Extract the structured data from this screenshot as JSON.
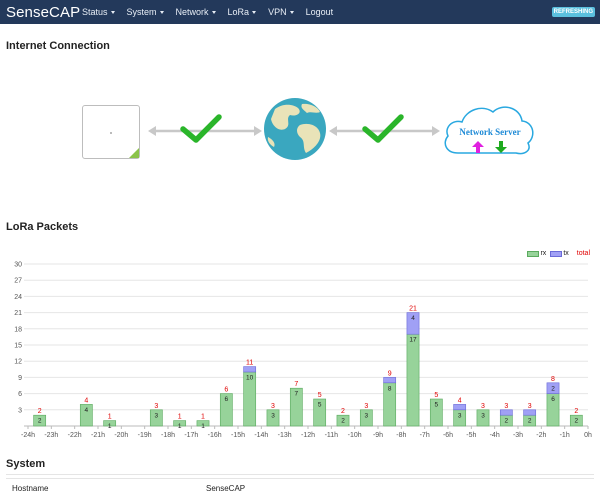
{
  "nav": {
    "brand": "SenseCAP",
    "items": [
      {
        "label": "Status",
        "dropdown": true
      },
      {
        "label": "System",
        "dropdown": true
      },
      {
        "label": "Network",
        "dropdown": true
      },
      {
        "label": "LoRa",
        "dropdown": true
      },
      {
        "label": "VPN",
        "dropdown": true
      },
      {
        "label": "Logout",
        "dropdown": false
      }
    ],
    "refresh_badge": "REFRESHING"
  },
  "internet": {
    "title": "Internet Connection",
    "server_label": "Network Server",
    "gateway_status": "connected",
    "server_status": "connected"
  },
  "lora": {
    "title": "LoRa Packets"
  },
  "chart_data": {
    "type": "bar",
    "stacked": true,
    "categories": [
      "-24h",
      "-23h",
      "-22h",
      "-21h",
      "-20h",
      "-19h",
      "-18h",
      "-17h",
      "-16h",
      "-15h",
      "-14h",
      "-13h",
      "-12h",
      "-11h",
      "-10h",
      "-9h",
      "-8h",
      "-7h",
      "-6h",
      "-5h",
      "-4h",
      "-3h",
      "-2h",
      "-1h",
      "0h"
    ],
    "series": [
      {
        "name": "rx",
        "color": "#97d39a",
        "values": [
          2,
          0,
          4,
          1,
          0,
          3,
          1,
          1,
          6,
          10,
          3,
          7,
          5,
          2,
          3,
          8,
          17,
          5,
          3,
          3,
          2,
          2,
          6,
          2
        ]
      },
      {
        "name": "tx",
        "color": "#a0a0f5",
        "values": [
          0,
          0,
          0,
          0,
          0,
          0,
          0,
          0,
          0,
          1,
          0,
          0,
          0,
          0,
          0,
          1,
          4,
          0,
          1,
          0,
          1,
          1,
          2,
          0
        ]
      }
    ],
    "totals": [
      2,
      0,
      4,
      1,
      0,
      3,
      1,
      1,
      6,
      11,
      3,
      7,
      5,
      2,
      3,
      9,
      21,
      5,
      4,
      3,
      3,
      3,
      8,
      2
    ],
    "legend": [
      "rx",
      "tx",
      "total"
    ],
    "total_label_color": "#e00000",
    "yticks": [
      3,
      6,
      9,
      12,
      15,
      18,
      21,
      24,
      27,
      30
    ],
    "ylim": [
      0,
      30
    ],
    "grid": true,
    "legend_position": "top-right"
  },
  "system": {
    "title": "System",
    "rows": [
      {
        "key": "Hostname",
        "value": "SenseCAP"
      }
    ]
  }
}
